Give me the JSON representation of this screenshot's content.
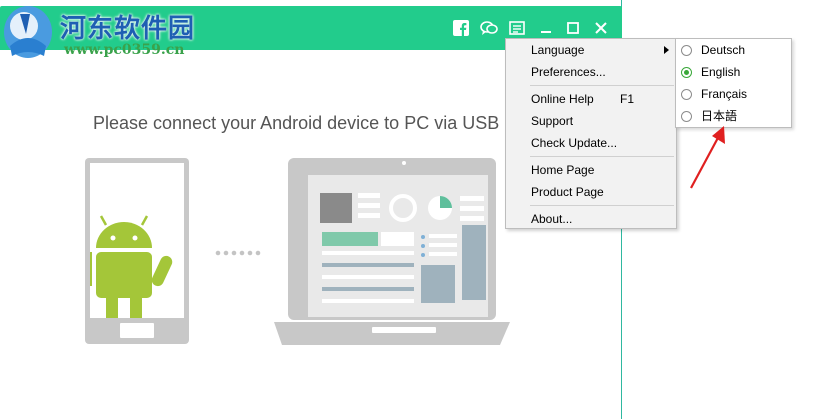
{
  "watermark": {
    "title": "河东软件园",
    "url": "www.pc0359.cn"
  },
  "title_bar": {
    "color": "#22cc8c",
    "icons": [
      "facebook-icon",
      "feedback-icon",
      "menu-icon",
      "minimize-icon",
      "maximize-icon",
      "close-icon"
    ]
  },
  "main": {
    "connect_text": "Please connect your Android device to PC via USB"
  },
  "menu": {
    "items": [
      {
        "label": "Language",
        "has_submenu": true
      },
      {
        "label": "Preferences..."
      },
      {
        "label": "Online Help",
        "shortcut": "F1"
      },
      {
        "label": "Support"
      },
      {
        "label": "Check Update..."
      },
      {
        "label": "Home Page"
      },
      {
        "label": "Product Page"
      },
      {
        "label": "About..."
      }
    ]
  },
  "language_menu": {
    "items": [
      {
        "label": "Deutsch",
        "selected": false
      },
      {
        "label": "English",
        "selected": true
      },
      {
        "label": "Français",
        "selected": false
      },
      {
        "label": "日本語",
        "selected": false
      }
    ]
  },
  "colors": {
    "accent": "#22cc8c",
    "android_green": "#a4c639",
    "annotation_arrow": "#e02020"
  }
}
